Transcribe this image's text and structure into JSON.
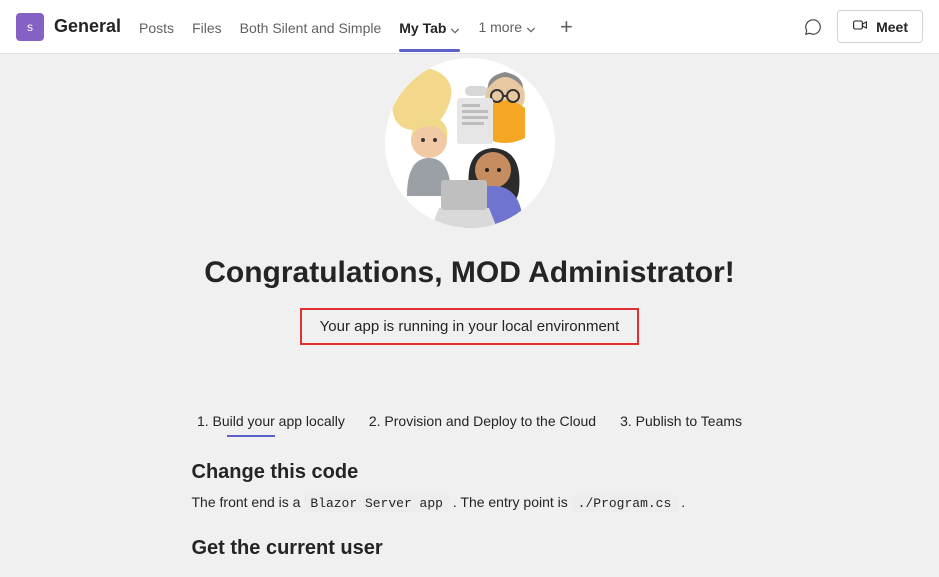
{
  "header": {
    "team_avatar_letter": "s",
    "channel_name": "General",
    "tabs": {
      "posts": "Posts",
      "files": "Files",
      "both": "Both Silent and Simple",
      "mytab": "My Tab"
    },
    "more_label": "1 more",
    "meet_label": "Meet"
  },
  "content": {
    "congrats_heading": "Congratulations, MOD Administrator!",
    "env_message": "Your app is running in your local environment",
    "steps": {
      "s1": "1. Build your app locally",
      "s2": "2. Provision and Deploy to the Cloud",
      "s3": "3. Publish to Teams"
    },
    "section1": {
      "heading": "Change this code",
      "text_prefix": "The front end is a ",
      "code1": "Blazor Server app",
      "text_mid": ". The entry point is ",
      "code2": "./Program.cs",
      "text_suffix": "."
    },
    "section2": {
      "heading": "Get the current user"
    }
  }
}
